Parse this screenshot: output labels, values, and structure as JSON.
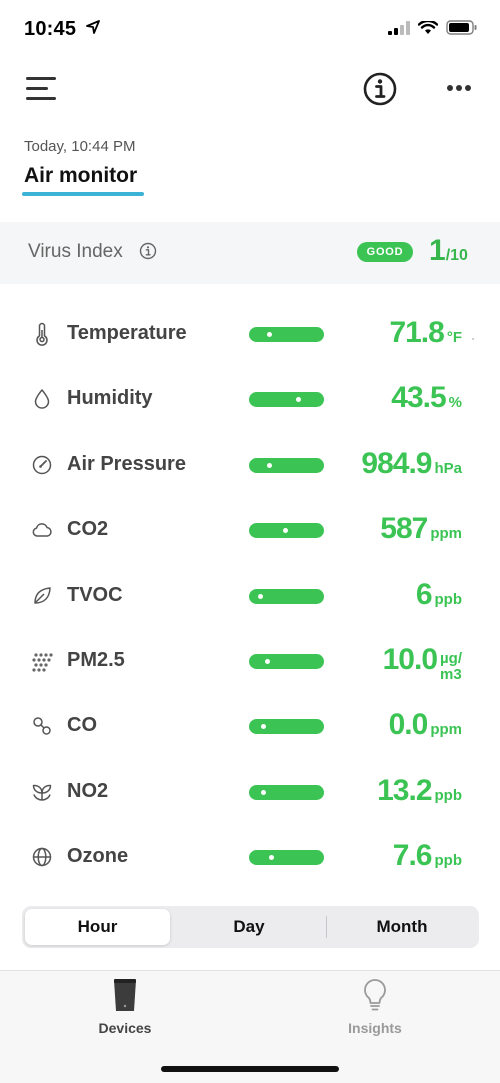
{
  "status_bar": {
    "time": "10:45"
  },
  "nav": {
    "icons": [
      "menu-icon",
      "info-icon",
      "more-icon"
    ]
  },
  "header": {
    "timestamp": "Today, 10:44 PM",
    "title": "Air monitor"
  },
  "virus_index": {
    "label": "Virus Index",
    "badge": "GOOD",
    "score": "1",
    "score_suffix": "/10"
  },
  "metrics": [
    {
      "icon": "thermometer-icon",
      "label": "Temperature",
      "value": "71.8",
      "unit": "°F",
      "level": 0.2
    },
    {
      "icon": "droplet-icon",
      "label": "Humidity",
      "value": "43.5",
      "unit": "%",
      "level": 0.7
    },
    {
      "icon": "gauge-icon",
      "label": "Air Pressure",
      "value": "984.9",
      "unit": "hPa",
      "level": 0.2
    },
    {
      "icon": "cloud-icon",
      "label": "CO2",
      "value": "587",
      "unit": "ppm",
      "level": 0.49
    },
    {
      "icon": "leaf-icon",
      "label": "TVOC",
      "value": "6",
      "unit": "ppb",
      "level": 0.05
    },
    {
      "icon": "particles-icon",
      "label": "PM2.5",
      "value": "10.0",
      "unit_top": "µg/",
      "unit_bottom": "m3",
      "level": 0.18
    },
    {
      "icon": "molecule-icon",
      "label": "CO",
      "value": "0.0",
      "unit": "ppm",
      "level": 0.1
    },
    {
      "icon": "sprout-icon",
      "label": "NO2",
      "value": "13.2",
      "unit": "ppb",
      "level": 0.1
    },
    {
      "icon": "globe-icon",
      "label": "Ozone",
      "value": "7.6",
      "unit": "ppb",
      "level": 0.24
    }
  ],
  "segmented": {
    "options": [
      "Hour",
      "Day",
      "Month"
    ],
    "selected": "Hour"
  },
  "tab_bar": {
    "tabs": [
      {
        "label": "Devices",
        "icon": "device-icon"
      },
      {
        "label": "Insights",
        "icon": "lightbulb-icon"
      }
    ]
  },
  "colors": {
    "good_green": "#3bc454",
    "accent_blue": "#3ab3d6"
  }
}
